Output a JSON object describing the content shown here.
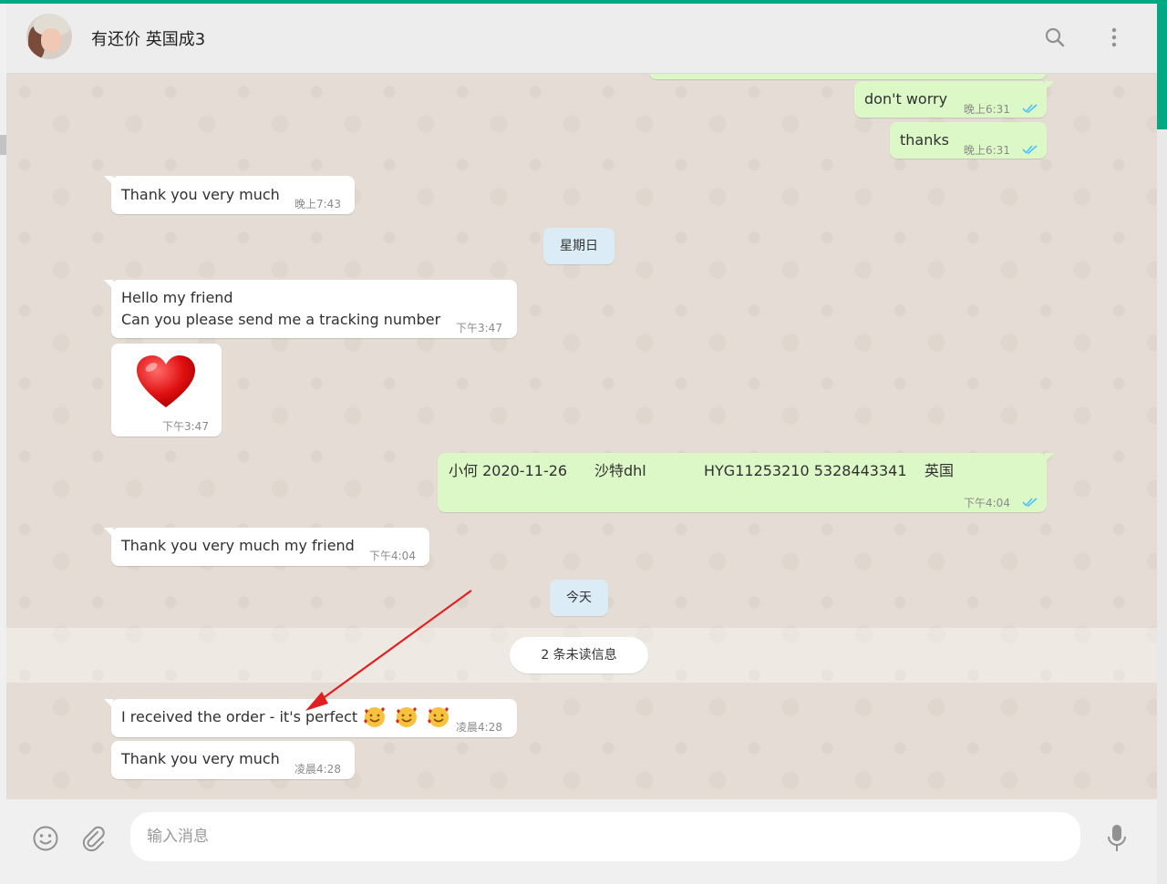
{
  "header": {
    "contact_name": "有还价 英国成3",
    "icons": [
      "search-icon",
      "menu-icon"
    ]
  },
  "messages": [
    {
      "id": "m1",
      "dir": "out",
      "text": "don't worry",
      "time": "晚上6:31",
      "ticks": "read"
    },
    {
      "id": "m2",
      "dir": "out",
      "text": "thanks",
      "time": "晚上6:31",
      "ticks": "read"
    },
    {
      "id": "m3",
      "dir": "in",
      "text": "Thank you very much",
      "time": "晚上7:43"
    },
    {
      "id": "m4",
      "dir": "in",
      "text_line1": "Hello my friend",
      "text_line2": "Can you please send me a tracking number",
      "time": "下午3:47"
    },
    {
      "id": "m5",
      "dir": "in",
      "emoji": "heart",
      "time": "下午3:47"
    },
    {
      "id": "m6",
      "dir": "out",
      "part1": "小何 2020-11-26",
      "part2": "沙特dhl",
      "part3": "HYG11253210 5328443341",
      "part4": "英国",
      "time": "下午4:04",
      "ticks": "read"
    },
    {
      "id": "m7",
      "dir": "in",
      "text": "Thank you very much my friend",
      "time": "下午4:04"
    },
    {
      "id": "m8",
      "dir": "in",
      "text": "I received the order - it's perfect",
      "emoji": "smiling-face-with-hearts x3",
      "time": "凌晨4:28"
    },
    {
      "id": "m9",
      "dir": "in",
      "text": "Thank you very much",
      "time": "凌晨4:28"
    }
  ],
  "date_separators": {
    "sunday": "星期日",
    "today": "今天"
  },
  "unread_banner": "2 条未读信息",
  "footer": {
    "input_placeholder": "输入消息"
  },
  "colors": {
    "accent": "#00a884",
    "outgoing_bubble": "#dcf8c6",
    "incoming_bubble": "#ffffff",
    "chat_bg": "#e5ddd5",
    "read_tick": "#4fc3f7",
    "annotation_arrow": "#e02020"
  }
}
